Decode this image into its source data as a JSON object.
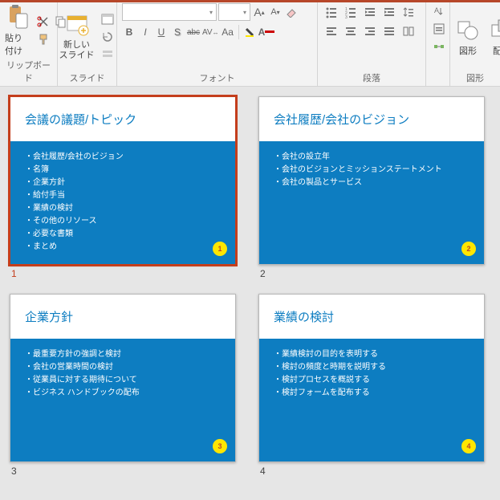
{
  "ribbon": {
    "groups": {
      "clipboard": {
        "label": "リップボード",
        "paste": "貼り付け"
      },
      "slides": {
        "label": "スライド",
        "new_slide": "新しい\nスライド"
      },
      "font": {
        "label": "フォント",
        "bold": "B",
        "italic": "I",
        "underline": "U",
        "shadow": "S",
        "strike": "abc",
        "spacing": "AV",
        "case": "Aa",
        "increase": "A",
        "decrease": "A"
      },
      "paragraph": {
        "label": "段落"
      },
      "drawing": {
        "label": "図形",
        "shapes": "図形",
        "arrange": "配置"
      }
    }
  },
  "slides": [
    {
      "number": "1",
      "title": "会議の議題/トピック",
      "selected": true,
      "bullets": [
        "会社履歴/会社のビジョン",
        "名簿",
        "企業方針",
        "給付手当",
        "業績の検討",
        "その他のリソース",
        "必要な書類",
        "まとめ"
      ]
    },
    {
      "number": "2",
      "title": "会社履歴/会社のビジョン",
      "selected": false,
      "bullets": [
        "会社の設立年",
        "会社のビジョンとミッションステートメント",
        "会社の製品とサービス"
      ]
    },
    {
      "number": "3",
      "title": "企業方針",
      "selected": false,
      "bullets": [
        "最重要方針の強調と検討",
        "会社の営業時間の検討",
        "従業員に対する期待について",
        "ビジネス ハンドブックの配布"
      ]
    },
    {
      "number": "4",
      "title": "業績の検討",
      "selected": false,
      "bullets": [
        "業績検討の目的を表明する",
        "検討の頻度と時期を説明する",
        "検討プロセスを概説する",
        "検討フォームを配布する"
      ]
    }
  ]
}
